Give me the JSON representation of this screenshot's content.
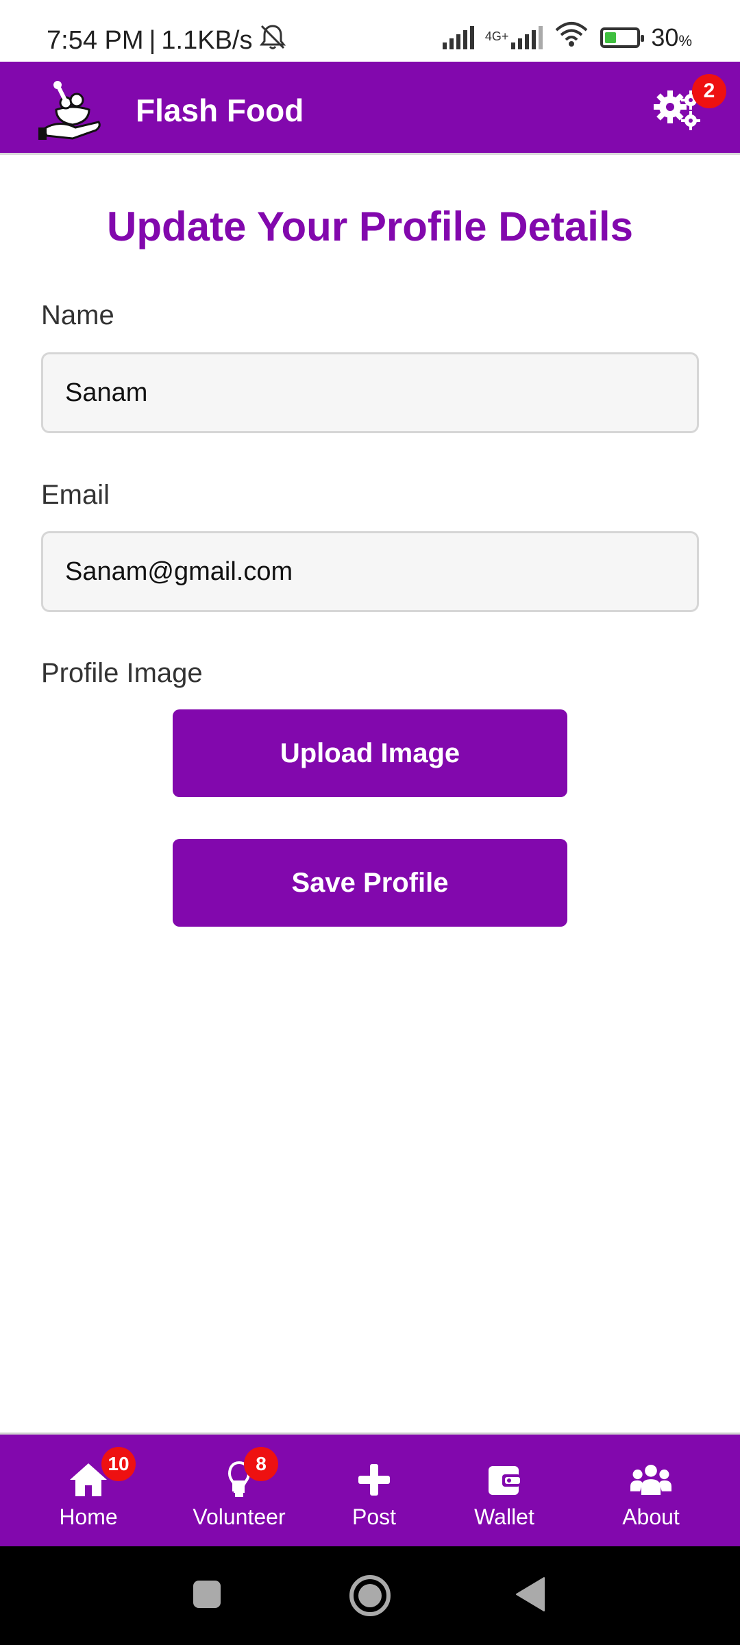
{
  "status_bar": {
    "time": "7:54 PM",
    "separator": "|",
    "speed": "1.1KB/s",
    "network_label": "4G+",
    "battery_percent": "30",
    "battery_unit": "%"
  },
  "app_bar": {
    "title": "Flash Food",
    "settings_badge": "2"
  },
  "page": {
    "title": "Update Your Profile Details",
    "name_label": "Name",
    "name_value": "Sanam",
    "email_label": "Email",
    "email_value": "Sanam@gmail.com",
    "image_label": "Profile Image",
    "upload_button": "Upload Image",
    "save_button": "Save Profile"
  },
  "bottom_nav": {
    "items": [
      {
        "label": "Home",
        "icon": "home-icon",
        "badge": "10"
      },
      {
        "label": "Volunteer",
        "icon": "volunteer-icon",
        "badge": "8"
      },
      {
        "label": "Post",
        "icon": "plus-icon",
        "badge": ""
      },
      {
        "label": "Wallet",
        "icon": "wallet-icon",
        "badge": ""
      },
      {
        "label": "About",
        "icon": "group-icon",
        "badge": ""
      }
    ]
  },
  "colors": {
    "primary": "#8208ad",
    "badge": "#ee1111",
    "background": "#ffffff"
  }
}
